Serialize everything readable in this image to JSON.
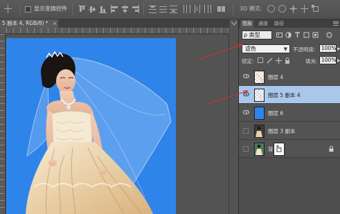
{
  "options_bar": {
    "show_transform_controls_label": "显示变换控件",
    "mode_3d_label": "3D 模式:",
    "align_icons": [
      "align-top-icon",
      "align-vcenter-icon",
      "align-bottom-icon",
      "align-left-icon",
      "align-hcenter-icon",
      "align-right-icon"
    ],
    "distribute_icons": [
      "distribute-top-icon",
      "distribute-vcenter-icon",
      "distribute-bottom-icon",
      "distribute-left-icon",
      "distribute-hcenter-icon",
      "distribute-right-icon"
    ],
    "mode_3d_icons": [
      "rotate-3d-icon",
      "roll-3d-icon",
      "pan-3d-icon",
      "slide-3d-icon",
      "scale-3d-icon"
    ]
  },
  "document_tab": {
    "title": "5 副本 4, RGB/8) *",
    "close_glyph": "×"
  },
  "layers_panel": {
    "tabs": [
      "图层",
      "通道",
      "路径"
    ],
    "active_tab": "图层",
    "filter_label": "ρ 类型",
    "blend_mode": "滤色",
    "opacity_label": "不透明度:",
    "opacity_value": "100%",
    "lock_label": "锁定:",
    "fill_label": "填充:",
    "fill_value": "100%",
    "layers": [
      {
        "name": "图层 4",
        "visible": true,
        "selected": false,
        "thumb": "white-veil",
        "locked": false
      },
      {
        "name": "图层 5 副本 4",
        "visible": true,
        "selected": true,
        "thumb": "white-veil",
        "locked": false
      },
      {
        "name": "图层 6",
        "visible": true,
        "selected": false,
        "thumb": "blue-fill",
        "locked": false
      },
      {
        "name": "图层 3 副本",
        "visible": false,
        "selected": false,
        "thumb": "bride-dark",
        "locked": false
      },
      {
        "name": "背",
        "visible": false,
        "selected": false,
        "thumb": "bride-green",
        "locked": true
      }
    ]
  },
  "colors": {
    "canvas_background": "#2f84ea",
    "selected_layer": "#a9c7ea",
    "annotation_arrow": "#d9302a"
  }
}
